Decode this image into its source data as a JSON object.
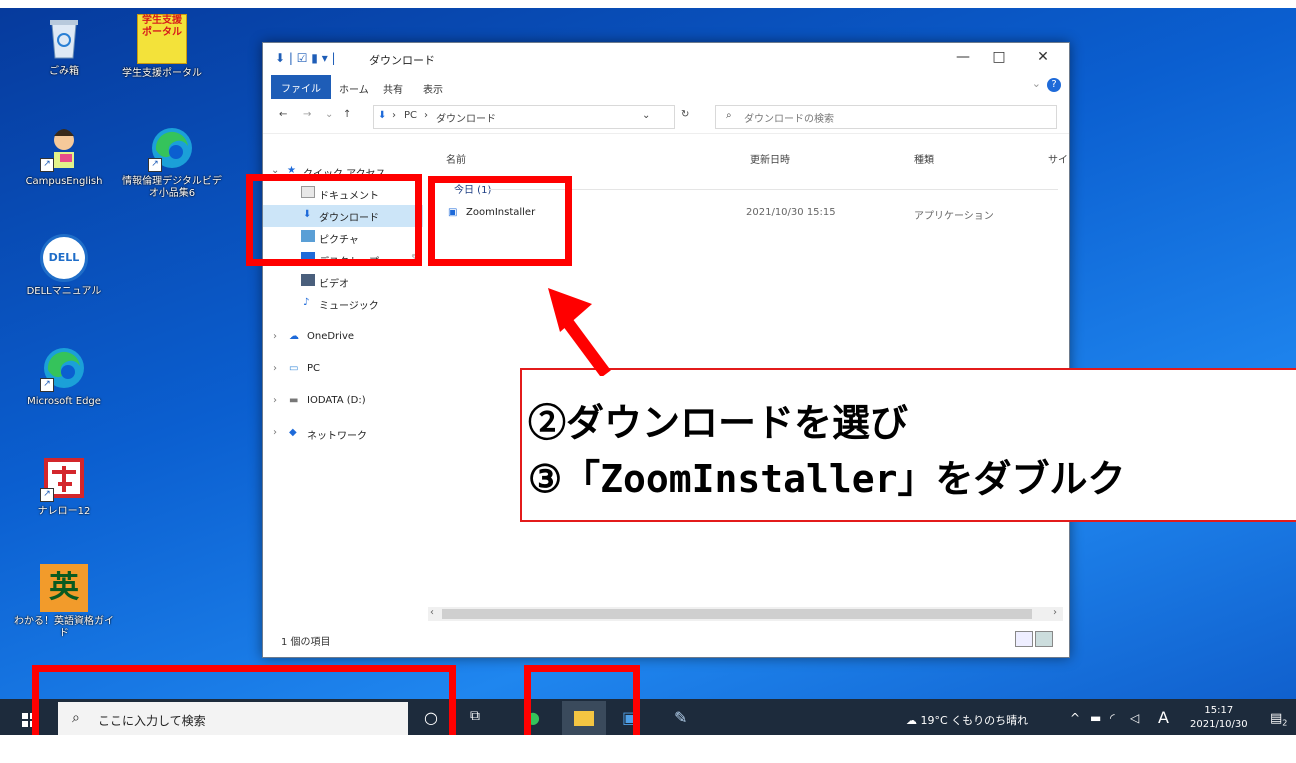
{
  "desktop": {
    "icons": [
      {
        "label": "ごみ箱",
        "icon": "recycle-bin-icon"
      },
      {
        "label": "学生支援ポータル",
        "icon_text": "学生支援\nポータル"
      },
      {
        "label": "CampusEnglish",
        "icon": "campus-english-icon"
      },
      {
        "label": "情報倫理デジタルビデオ小品集6",
        "icon": "edge-icon"
      },
      {
        "label": "DELLマニュアル",
        "icon_text": "DELL"
      },
      {
        "label": "Microsoft Edge",
        "icon": "edge-icon"
      },
      {
        "label": "ナレロー12",
        "icon": "nareroo-icon"
      },
      {
        "label": "わかる！英語資格ガイド",
        "icon_text": "英"
      }
    ]
  },
  "explorer": {
    "title": "ダウンロード",
    "quick_access_icons": [
      "download-arrow-icon",
      "checkbox-icon",
      "folder-icon"
    ],
    "window_controls": {
      "minimize": "—",
      "maximize": "□",
      "close": "✕"
    },
    "ribbon_tabs": [
      "ファイル",
      "ホーム",
      "共有",
      "表示"
    ],
    "help": "?",
    "address": {
      "pc": "PC",
      "folder": "ダウンロード",
      "separator": "›"
    },
    "search_placeholder": "ダウンロードの検索",
    "nav": {
      "quick_access": "クイック アクセス",
      "items": [
        "ドキュメント",
        "ダウンロード",
        "ピクチャ",
        "デスクトップ",
        "ビデオ",
        "ミュージック"
      ],
      "onedrive": "OneDrive",
      "pc": "PC",
      "iodata": "IODATA (D:)",
      "network": "ネットワーク"
    },
    "columns": {
      "name": "名前",
      "date": "更新日時",
      "type": "種類",
      "size": "サイ"
    },
    "group_label": "今日 (1)",
    "files": [
      {
        "name": "ZoomInstaller",
        "date": "2021/10/30 15:15",
        "type": "アプリケーション"
      }
    ],
    "status": "1 個の項目"
  },
  "taskbar": {
    "search_placeholder": "ここに入力して検索",
    "weather": "19°C くもりのち晴れ",
    "ime": "A",
    "time": "15:17",
    "date": "2021/10/30",
    "notification_badge": "2"
  },
  "annotation": {
    "line1": "②ダウンロードを選び",
    "line2": "③「ZoomInstaller」をダブルク"
  },
  "colors": {
    "highlight": "#ff0000",
    "accent": "#1e5db7",
    "desktop": "#0b5fd0",
    "taskbar": "#1d2b3c"
  }
}
